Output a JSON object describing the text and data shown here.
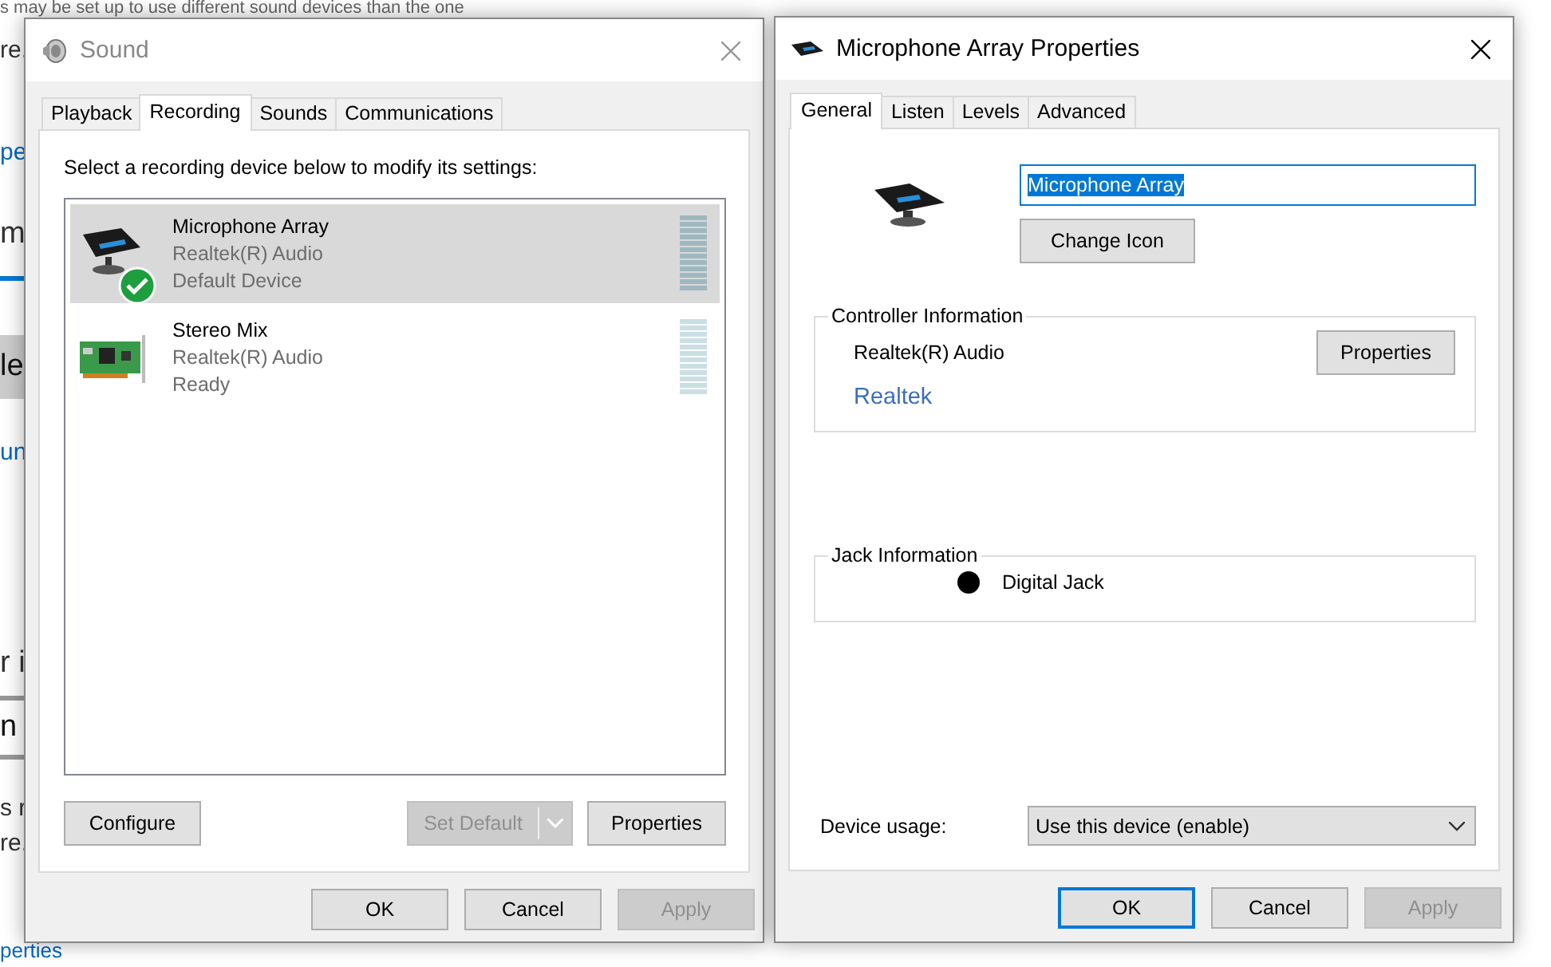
{
  "background_page": {
    "lines": [
      {
        "text": "s may be set up to use different sound devices than the one",
        "kind": "text"
      },
      {
        "text": "re.",
        "kind": "text"
      },
      {
        "text": "pe",
        "kind": "link"
      },
      {
        "text": "m",
        "kind": "heading"
      },
      {
        "text": "le",
        "kind": "highlight"
      },
      {
        "text": "un",
        "kind": "link"
      },
      {
        "text": "r i",
        "kind": "heading"
      },
      {
        "text": "n",
        "kind": "field"
      },
      {
        "text": "s r",
        "kind": "text"
      },
      {
        "text": "re.",
        "kind": "text"
      },
      {
        "text": "perties",
        "kind": "link"
      }
    ]
  },
  "sound_window": {
    "title": "Sound",
    "active": false,
    "tabs": [
      {
        "label": "Playback",
        "selected": false
      },
      {
        "label": "Recording",
        "selected": true
      },
      {
        "label": "Sounds",
        "selected": false
      },
      {
        "label": "Communications",
        "selected": false
      }
    ],
    "instruction": "Select a recording device below to modify its settings:",
    "devices": [
      {
        "kind": "microphone",
        "name": "Microphone Array",
        "driver": "Realtek(R) Audio",
        "status": "Default Device",
        "selected": true,
        "default": true
      },
      {
        "kind": "sound-card",
        "name": "Stereo Mix",
        "driver": "Realtek(R) Audio",
        "status": "Ready",
        "selected": false,
        "default": false
      }
    ],
    "actions": [
      {
        "label": "Configure",
        "disabled": false,
        "split": false
      },
      {
        "label": "Set Default",
        "disabled": true,
        "split": true
      },
      {
        "label": "Properties",
        "disabled": false,
        "split": false
      }
    ],
    "footer_buttons": [
      {
        "label": "OK",
        "disabled": false,
        "default": false
      },
      {
        "label": "Cancel",
        "disabled": false,
        "default": false
      },
      {
        "label": "Apply",
        "disabled": true,
        "default": false
      }
    ]
  },
  "properties_window": {
    "title": "Microphone Array Properties",
    "active": true,
    "tabs": [
      {
        "label": "General",
        "selected": true
      },
      {
        "label": "Listen",
        "selected": false
      },
      {
        "label": "Levels",
        "selected": false
      },
      {
        "label": "Advanced",
        "selected": false
      }
    ],
    "name_field": {
      "value": "Microphone Array",
      "text_selected": true
    },
    "change_icon_button": "Change Icon",
    "controller_group": {
      "title": "Controller Information",
      "driver": "Realtek(R) Audio",
      "button": "Properties",
      "link": "Realtek"
    },
    "jack_group": {
      "title": "Jack Information",
      "jacks": [
        {
          "label": "Digital Jack",
          "color": "#000000"
        }
      ]
    },
    "device_usage": {
      "label": "Device usage:",
      "value": "Use this device (enable)"
    },
    "footer_buttons": [
      {
        "label": "OK",
        "disabled": false,
        "default": true
      },
      {
        "label": "Cancel",
        "disabled": false,
        "default": false
      },
      {
        "label": "Apply",
        "disabled": true,
        "default": false
      }
    ]
  }
}
